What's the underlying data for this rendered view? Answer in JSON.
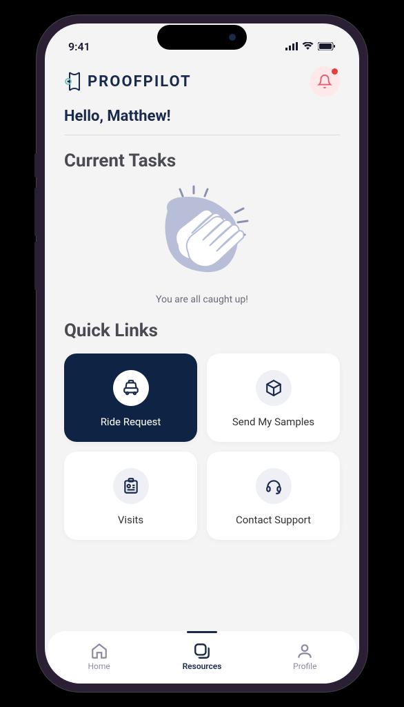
{
  "status": {
    "time": "9:41"
  },
  "app": {
    "name": "PROOFPILOT"
  },
  "greeting": "Hello, Matthew!",
  "sections": {
    "tasks_title": "Current Tasks",
    "tasks_empty": "You are all caught up!",
    "quick_links_title": "Quick Links"
  },
  "quick_links": [
    {
      "label": "Ride Request",
      "icon": "taxi",
      "active": true
    },
    {
      "label": "Send My Samples",
      "icon": "box",
      "active": false
    },
    {
      "label": "Visits",
      "icon": "badge",
      "active": false
    },
    {
      "label": "Contact Support",
      "icon": "headset",
      "active": false
    }
  ],
  "nav": [
    {
      "label": "Home",
      "active": false
    },
    {
      "label": "Resources",
      "active": true
    },
    {
      "label": "Profile",
      "active": false
    }
  ]
}
